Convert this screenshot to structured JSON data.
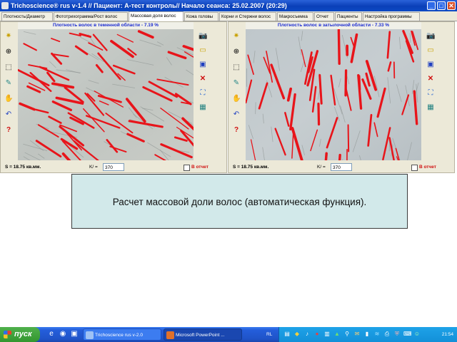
{
  "window": {
    "title": "Trichoscience® rus v-1.4 // Пациент:  А-тест контроль// Начало сеанса: 25.02.2007 (20:29)",
    "buttons": {
      "minimize": "_",
      "maximize": "□",
      "close": "✕"
    }
  },
  "tabs": [
    {
      "label": "Плотность/Диаметр"
    },
    {
      "label": "Фототрихограмма/Рост волос"
    },
    {
      "label": "Массовая доля волос",
      "active": true
    },
    {
      "label": "Кожа головы"
    },
    {
      "label": "Корни и Стержни волос"
    },
    {
      "label": "Макросъемка"
    },
    {
      "label": "Отчет"
    },
    {
      "label": "Пациенты"
    },
    {
      "label": "Настройка программы"
    }
  ],
  "left_panel": {
    "header": "Плотность волос в теменной области - 7.19 %",
    "area": "S = 18.75 кв.мм.",
    "k_label": "K/ =",
    "k_value": "370",
    "report_label": "В отчет"
  },
  "right_panel": {
    "header": "Плотность волос в затылочной области - 7.33 %",
    "area": "S = 18.75 кв.мм.",
    "k_label": "K/ =",
    "k_value": "370",
    "report_label": "В отчет"
  },
  "left_tools": [
    "magic-wand-icon",
    "crosshair-icon",
    "select-rect-icon",
    "brush-icon",
    "hand-icon",
    "undo-icon",
    "help-icon"
  ],
  "right_tools": [
    "camera-icon",
    "open-folder-icon",
    "save-icon",
    "delete-icon",
    "fit-icon",
    "grid-icon"
  ],
  "caption": "Расчет массовой доли волос (автоматическая функция).",
  "taskbar": {
    "start_label": "пуск",
    "tasks": [
      {
        "label": "Trichoscience rus v-2.0",
        "active": false
      },
      {
        "label": "Microsoft PowerPoint ...",
        "active": true
      }
    ],
    "language": "RL",
    "clock": "21:54"
  },
  "colors": {
    "hair_marking": "#e8141a",
    "header_text": "#1a2ad0",
    "caption_bg": "#d2e9ea",
    "title_bar": "#0a3fb8",
    "taskbar": "#245edb",
    "start_button": "#3ba03b"
  }
}
